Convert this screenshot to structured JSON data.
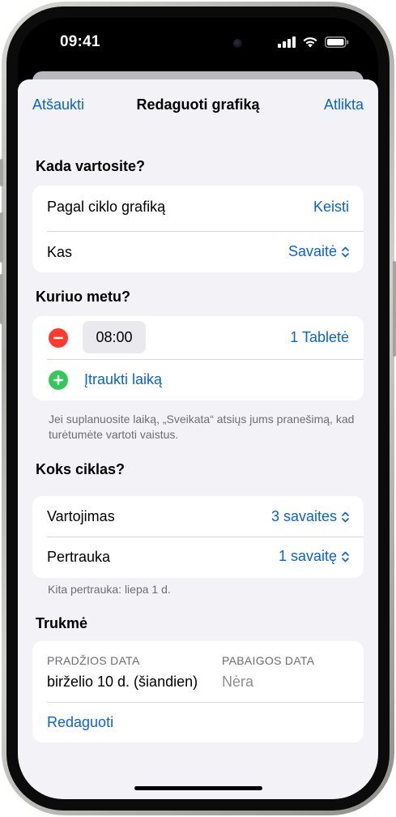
{
  "status_bar": {
    "time": "09:41"
  },
  "nav": {
    "cancel_label": "Atšaukti",
    "title": "Redaguoti grafiką",
    "done_label": "Atlikta"
  },
  "when": {
    "title": "Kada vartosite?",
    "cycle_label": "Pagal ciklo grafiką",
    "change_label": "Keisti",
    "what_label": "Kas",
    "what_value": "Savaitė"
  },
  "time_section": {
    "title": "Kuriuo metu?",
    "time_value": "08:00",
    "dose_value": "1 Tabletė",
    "add_time_label": "Įtraukti laiką",
    "footnote": "Jei suplanuosite laiką, „Sveikata“ atsiųs jums pranešimą, kad turėtumėte vartoti vaistus."
  },
  "cycle": {
    "title": "Koks ciklas?",
    "usage_label": "Vartojimas",
    "usage_value": "3 savaites",
    "break_label": "Pertrauka",
    "break_value": "1 savaitę",
    "footnote": "Kita pertrauka: liepa 1 d."
  },
  "duration": {
    "title": "Trukmė",
    "start_header": "PRADŽIOS DATA",
    "start_value": "birželio 10 d. (šiandien)",
    "end_header": "PABAIGOS DATA",
    "end_value": "Nėra",
    "edit_label": "Redaguoti"
  },
  "colors": {
    "accent": "#0a63d6",
    "destructive": "#ff3b30",
    "add": "#34c759",
    "background": "#f2f2f7"
  },
  "icons": [
    "signal-icon",
    "wifi-icon",
    "battery-icon",
    "minus-circle-icon",
    "plus-circle-icon",
    "updown-chevron-icon"
  ]
}
